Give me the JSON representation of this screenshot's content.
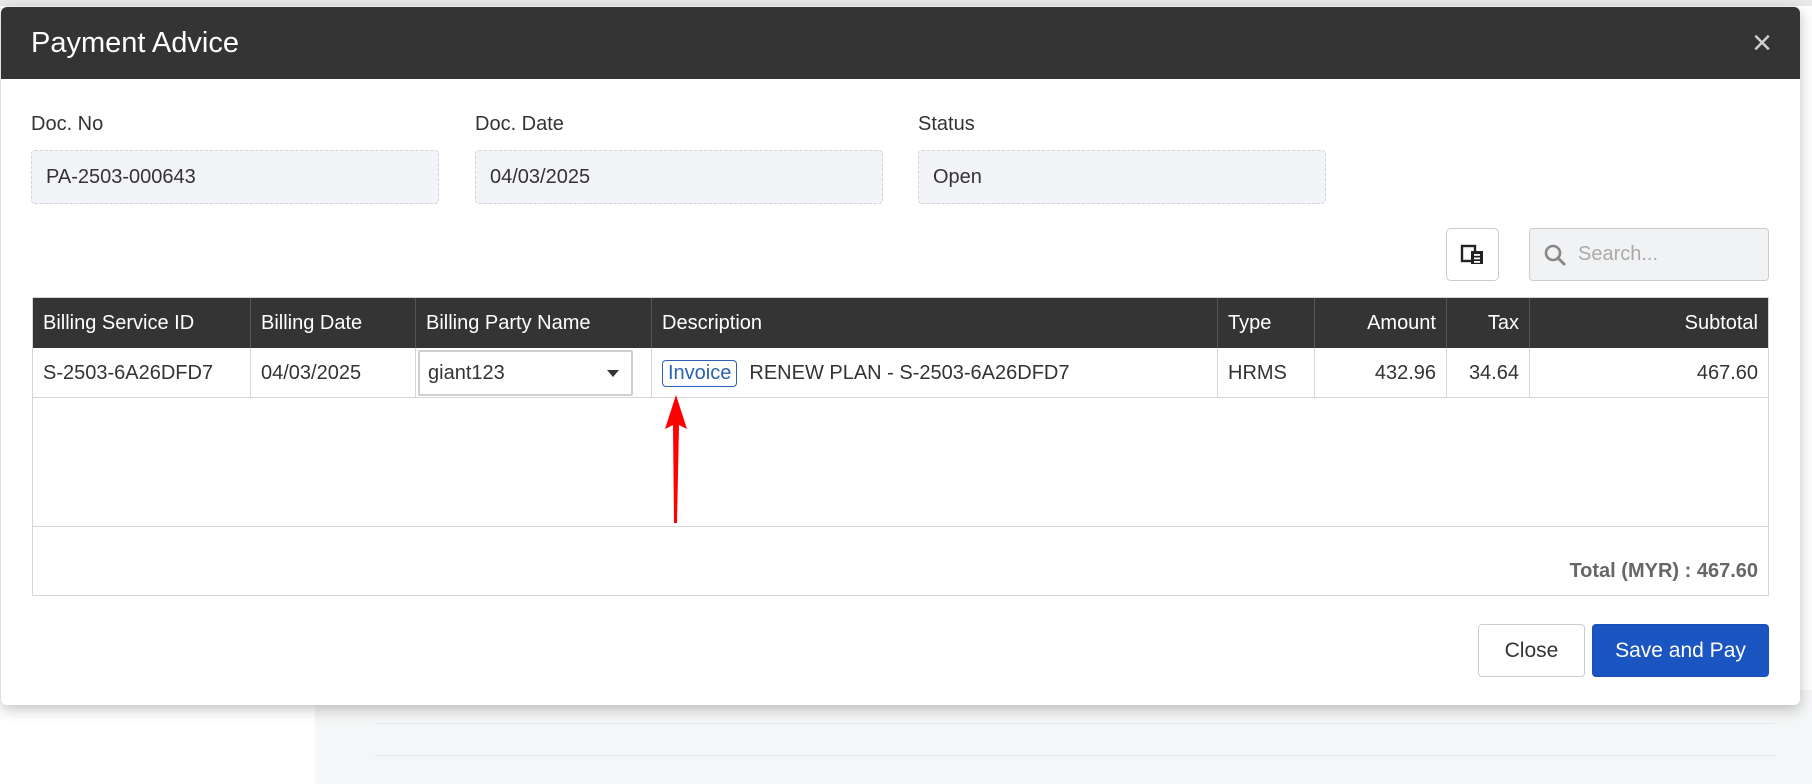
{
  "modal": {
    "title": "Payment Advice",
    "close_icon": "×"
  },
  "fields": {
    "doc_no": {
      "label": "Doc. No",
      "value": "PA-2503-000643"
    },
    "doc_date": {
      "label": "Doc. Date",
      "value": "04/03/2025"
    },
    "status": {
      "label": "Status",
      "value": "Open"
    }
  },
  "toolbar": {
    "export_icon": "export-icon",
    "search_placeholder": "Search..."
  },
  "table": {
    "headers": [
      "Billing Service ID",
      "Billing Date",
      "Billing Party Name",
      "Description",
      "Type",
      "Amount",
      "Tax",
      "Subtotal"
    ],
    "rows": [
      {
        "billing_service_id": "S-2503-6A26DFD7",
        "billing_date": "04/03/2025",
        "billing_party_name": "giant123",
        "invoice_tag": "Invoice",
        "description": "RENEW PLAN - S-2503-6A26DFD7",
        "type": "HRMS",
        "amount": "432.96",
        "tax": "34.64",
        "subtotal": "467.60"
      }
    ],
    "total_label": "Total (MYR) : 467.60"
  },
  "footer": {
    "close_label": "Close",
    "save_label": "Save and Pay"
  },
  "colors": {
    "header_bg": "#343434",
    "primary": "#1b55c1",
    "link": "#2b62b3",
    "annotation_arrow": "#ff0000"
  }
}
